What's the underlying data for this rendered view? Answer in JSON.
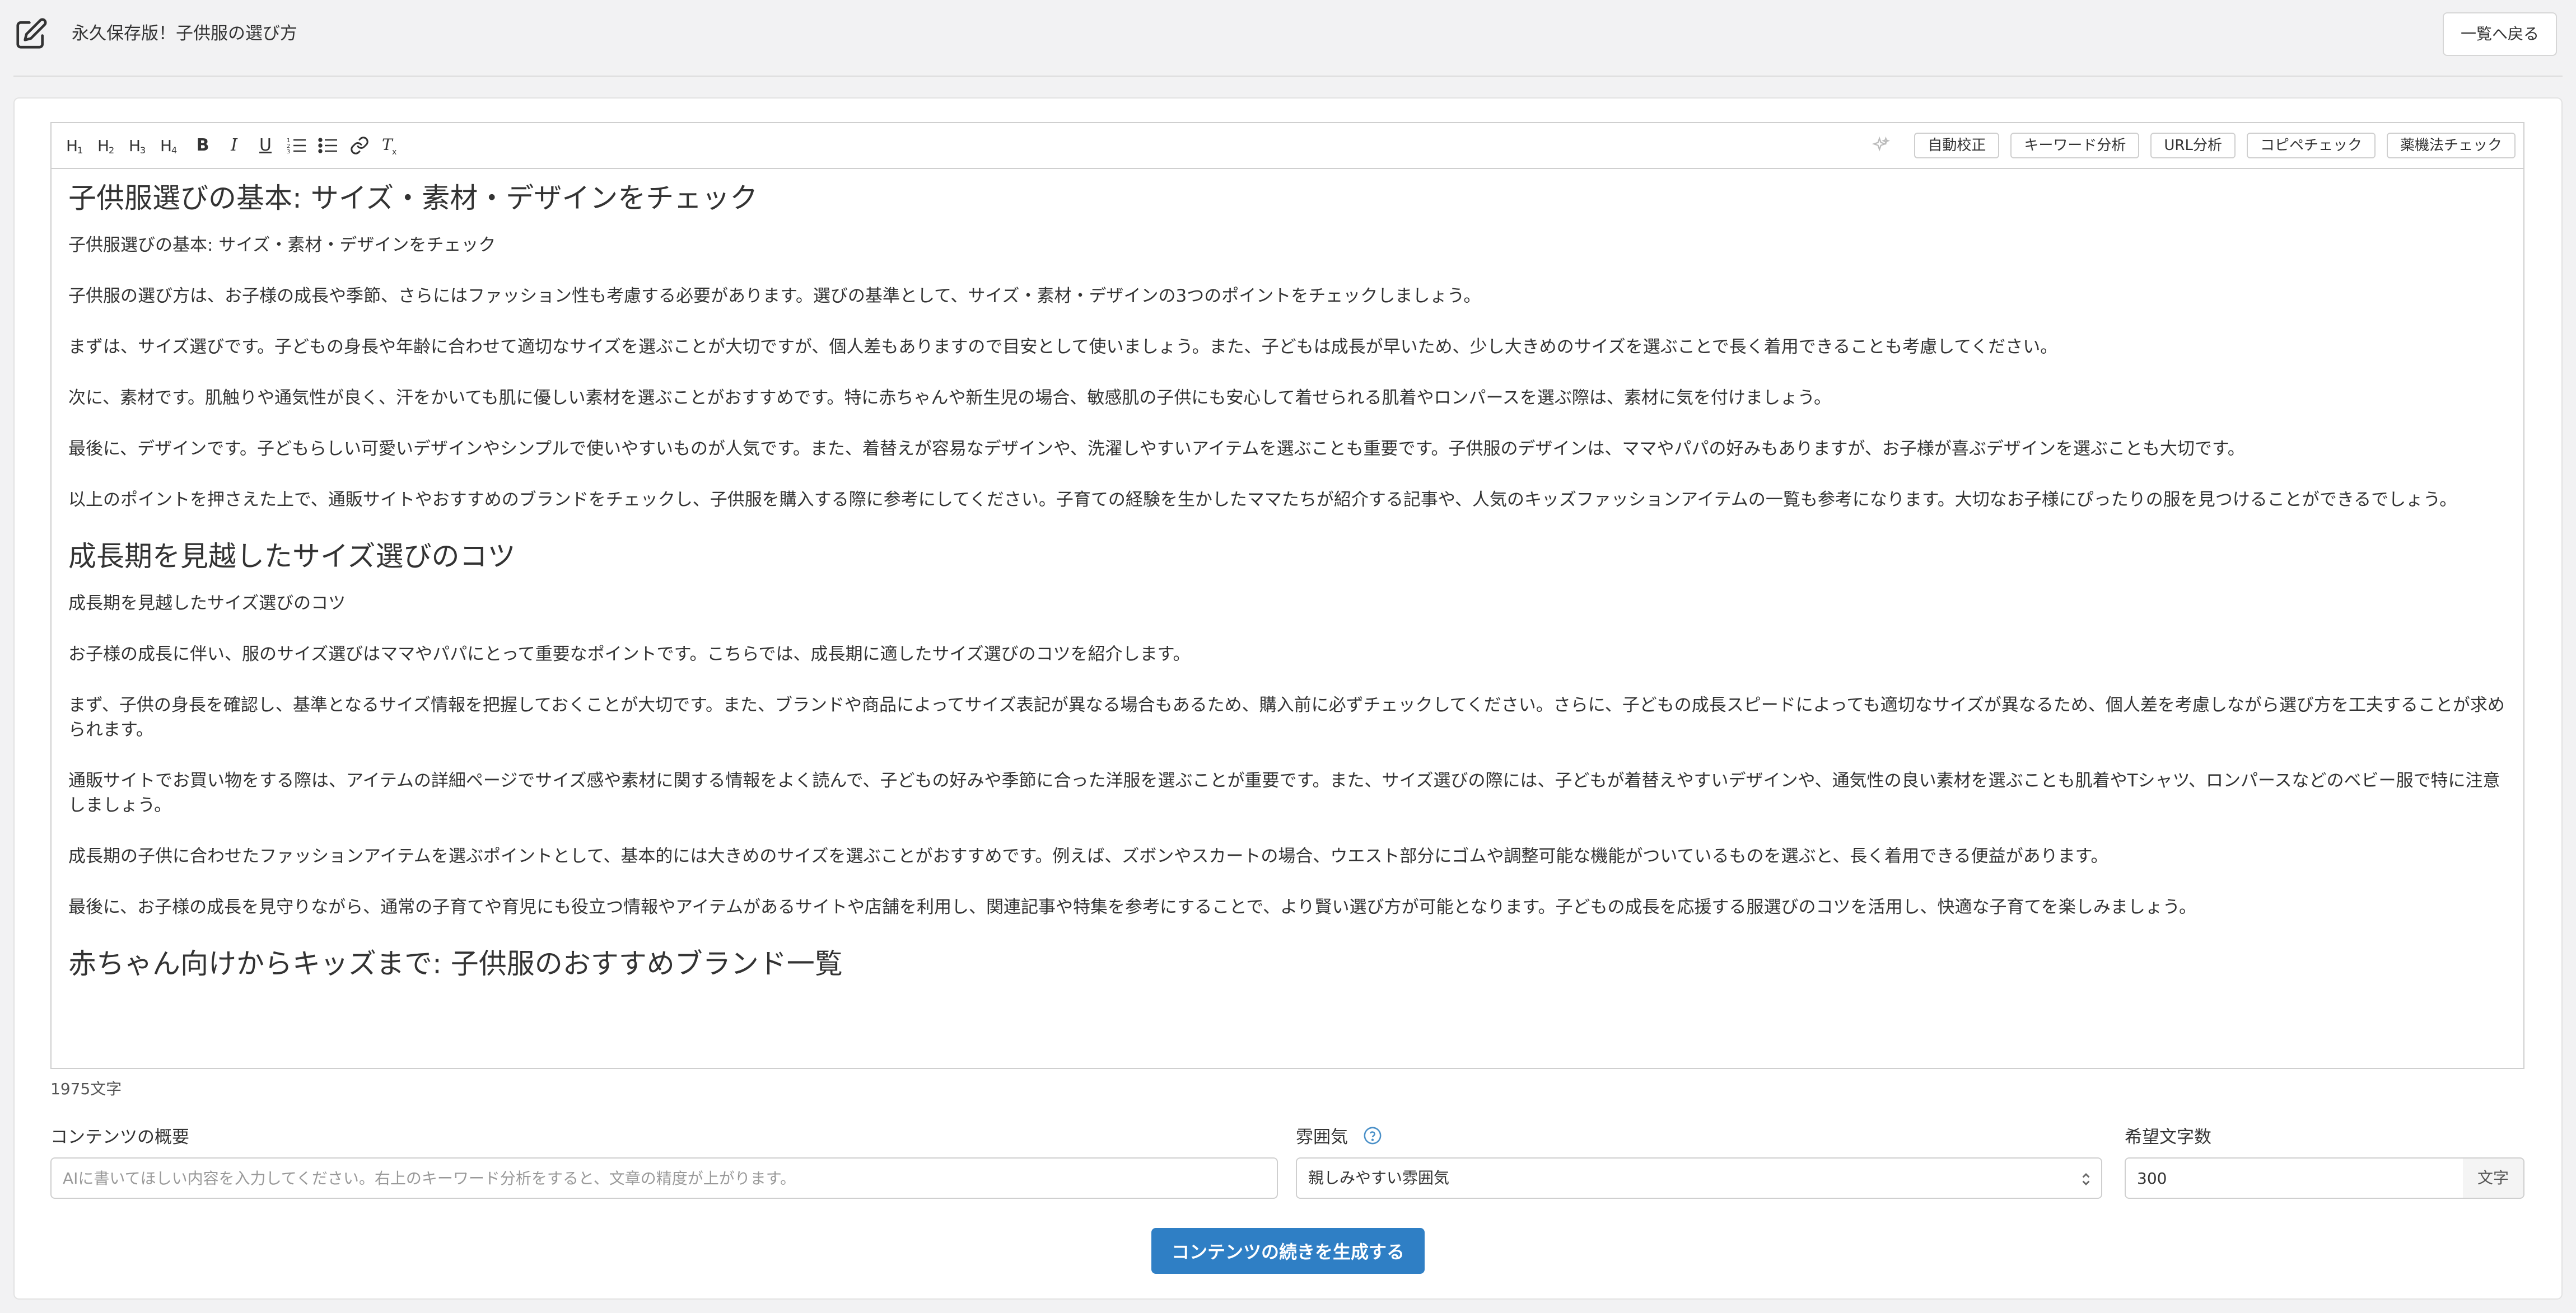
{
  "header": {
    "title": "永久保存版！子供服の選び方",
    "back_label": "一覧へ戻る"
  },
  "toolbar": {
    "format_buttons": [
      "H1",
      "H2",
      "H3",
      "H4",
      "B",
      "I",
      "U"
    ],
    "tools": [
      "自動校正",
      "キーワード分析",
      "URL分析",
      "コピペチェック",
      "薬機法チェック"
    ]
  },
  "content": [
    {
      "type": "h2",
      "text": "子供服選びの基本: サイズ・素材・デザインをチェック"
    },
    {
      "type": "p",
      "text": "子供服選びの基本: サイズ・素材・デザインをチェック"
    },
    {
      "type": "p",
      "text": "子供服の選び方は、お子様の成長や季節、さらにはファッション性も考慮する必要があります。選びの基準として、サイズ・素材・デザインの3つのポイントをチェックしましょう。"
    },
    {
      "type": "p",
      "text": "まずは、サイズ選びです。子どもの身長や年齢に合わせて適切なサイズを選ぶことが大切ですが、個人差もありますので目安として使いましょう。また、子どもは成長が早いため、少し大きめのサイズを選ぶことで長く着用できることも考慮してください。"
    },
    {
      "type": "p",
      "text": "次に、素材です。肌触りや通気性が良く、汗をかいても肌に優しい素材を選ぶことがおすすめです。特に赤ちゃんや新生児の場合、敏感肌の子供にも安心して着せられる肌着やロンパースを選ぶ際は、素材に気を付けましょう。"
    },
    {
      "type": "p",
      "text": "最後に、デザインです。子どもらしい可愛いデザインやシンプルで使いやすいものが人気です。また、着替えが容易なデザインや、洗濯しやすいアイテムを選ぶことも重要です。子供服のデザインは、ママやパパの好みもありますが、お子様が喜ぶデザインを選ぶことも大切です。"
    },
    {
      "type": "p",
      "text": "以上のポイントを押さえた上で、通販サイトやおすすめのブランドをチェックし、子供服を購入する際に参考にしてください。子育ての経験を生かしたママたちが紹介する記事や、人気のキッズファッションアイテムの一覧も参考になります。大切なお子様にぴったりの服を見つけることができるでしょう。"
    },
    {
      "type": "h2",
      "text": "成長期を見越したサイズ選びのコツ"
    },
    {
      "type": "p",
      "text": "成長期を見越したサイズ選びのコツ"
    },
    {
      "type": "p",
      "text": "お子様の成長に伴い、服のサイズ選びはママやパパにとって重要なポイントです。こちらでは、成長期に適したサイズ選びのコツを紹介します。"
    },
    {
      "type": "p",
      "text": "まず、子供の身長を確認し、基準となるサイズ情報を把握しておくことが大切です。また、ブランドや商品によってサイズ表記が異なる場合もあるため、購入前に必ずチェックしてください。さらに、子どもの成長スピードによっても適切なサイズが異なるため、個人差を考慮しながら選び方を工夫することが求められます。"
    },
    {
      "type": "p",
      "text": "通販サイトでお買い物をする際は、アイテムの詳細ページでサイズ感や素材に関する情報をよく読んで、子どもの好みや季節に合った洋服を選ぶことが重要です。また、サイズ選びの際には、子どもが着替えやすいデザインや、通気性の良い素材を選ぶことも肌着やTシャツ、ロンパースなどのベビー服で特に注意しましょう。"
    },
    {
      "type": "p",
      "text": "成長期の子供に合わせたファッションアイテムを選ぶポイントとして、基本的には大きめのサイズを選ぶことがおすすめです。例えば、ズボンやスカートの場合、ウエスト部分にゴムや調整可能な機能がついているものを選ぶと、長く着用できる便益があります。"
    },
    {
      "type": "p",
      "text": "最後に、お子様の成長を見守りながら、通常の子育てや育児にも役立つ情報やアイテムがあるサイトや店舗を利用し、関連記事や特集を参考にすることで、より賢い選び方が可能となります。子どもの成長を応援する服選びのコツを活用し、快適な子育てを楽しみましょう。"
    },
    {
      "type": "h2",
      "text": "赤ちゃん向けからキッズまで: 子供服のおすすめブランド一覧"
    }
  ],
  "char_count": "1975文字",
  "form": {
    "summary_label": "コンテンツの概要",
    "summary_placeholder": "AIに書いてほしい内容を入力してください。右上のキーワード分析をすると、文章の精度が上がります。",
    "tone_label": "雰囲気",
    "tone_value": "親しみやすい雰囲気",
    "length_label": "希望文字数",
    "length_value": "300",
    "length_unit": "文字",
    "generate_label": "コンテンツの続きを生成する"
  },
  "colors": {
    "primary_button": "#2f7fc5",
    "help_icon": "#4a90c8"
  }
}
